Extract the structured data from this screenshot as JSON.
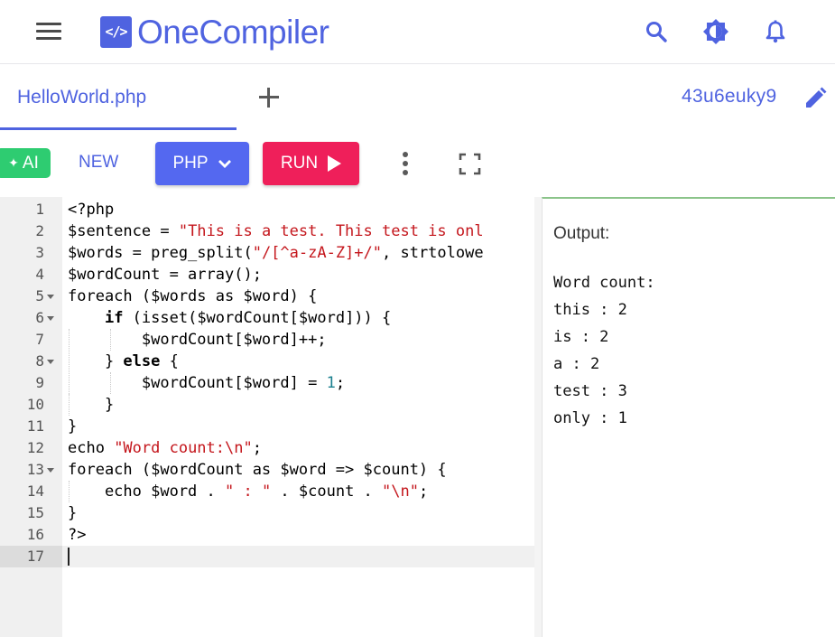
{
  "header": {
    "logo_mark": "</>",
    "logo_text": "OneCompiler",
    "icons": [
      "menu-icon",
      "search-icon",
      "brightness-icon",
      "notification-bell-icon"
    ],
    "accent_color": "#4f63e0"
  },
  "tabs": {
    "file_name": "HelloWorld.php",
    "code_id": "43u6euky9"
  },
  "toolbar": {
    "ai_label": "AI",
    "new_label": "NEW",
    "language_label": "PHP",
    "run_label": "RUN",
    "ai_color": "#2ecc71",
    "run_color": "#ef1f5a",
    "language_color": "#5468f0"
  },
  "editor": {
    "line_numbers": [
      "1",
      "2",
      "3",
      "4",
      "5",
      "6",
      "7",
      "8",
      "9",
      "10",
      "11",
      "12",
      "13",
      "14",
      "15",
      "16",
      "17"
    ],
    "lines": [
      "<?php",
      "$sentence = \"This is a test. This test is onl",
      "$words = preg_split(\"/[^a-zA-Z]+/\", strtolowe",
      "$wordCount = array();",
      "foreach ($words as $word) {",
      "    if (isset($wordCount[$word])) {",
      "        $wordCount[$word]++;",
      "    } else {",
      "        $wordCount[$word] = 1;",
      "    }",
      "}",
      "echo \"Word count:\\n\";",
      "foreach ($wordCount as $word => $count) {",
      "    echo $word . \" : \" . $count . \"\\n\";",
      "}",
      "?>",
      ""
    ]
  },
  "output": {
    "title": "Output:",
    "lines": [
      "Word count:",
      "this : 2",
      "is : 2",
      "a : 2",
      "test : 3",
      "only : 1"
    ]
  }
}
